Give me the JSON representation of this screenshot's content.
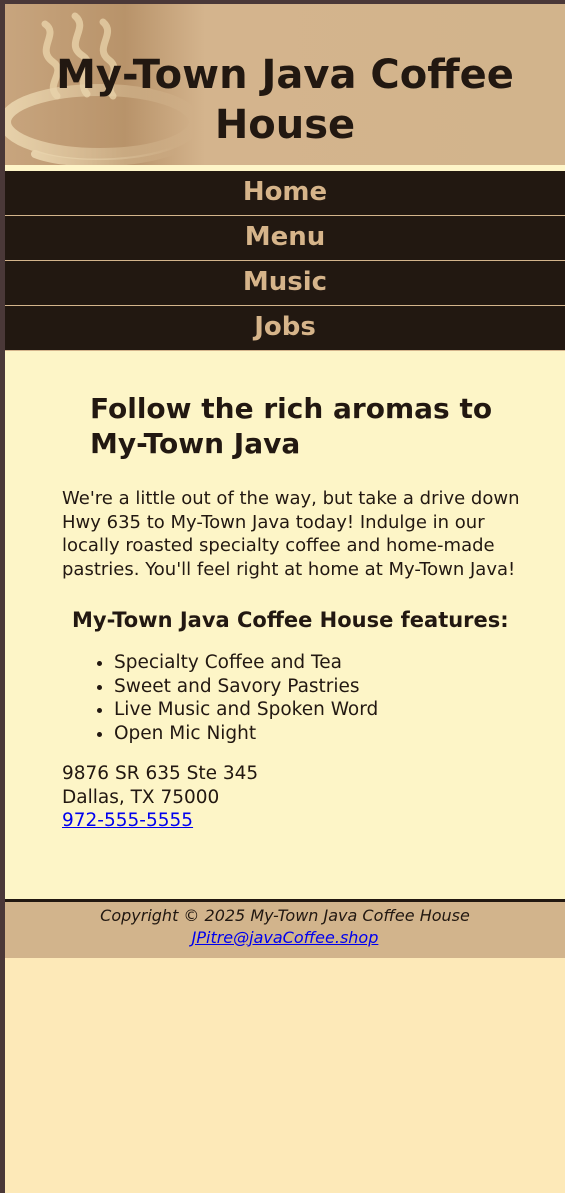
{
  "site": {
    "title": "My-Town Java Coffee House"
  },
  "nav": {
    "items": [
      {
        "label": "Home"
      },
      {
        "label": "Menu"
      },
      {
        "label": "Music"
      },
      {
        "label": "Jobs"
      }
    ]
  },
  "main": {
    "heading": "Follow the rich aromas to My-Town Java",
    "intro": "We're a little out of the way, but take a drive down Hwy 635 to My-Town Java today! Indulge in our locally roasted specialty coffee and home-made pastries. You'll feel right at home at My-Town Java!",
    "features_heading": "My-Town Java Coffee House features:",
    "features": [
      "Specialty Coffee and Tea",
      "Sweet and Savory Pastries",
      "Live Music and Spoken Word",
      "Open Mic Night"
    ],
    "address": {
      "street": "9876 SR 635 Ste 345",
      "city": "Dallas, TX 75000",
      "phone": "972-555-5555"
    }
  },
  "footer": {
    "copyright": "Copyright © 2025 My-Town Java Coffee House",
    "email": "JPitre@javaCoffee.shop"
  },
  "colors": {
    "page_bg": "#4a3838",
    "wrapper_bg": "#fde9b8",
    "header_bg": "#d2b48c",
    "nav_bg": "#221811",
    "nav_text": "#d6b48a",
    "main_bg": "#fdf5c7",
    "text": "#221811",
    "link": "#0000ee"
  },
  "icons": {
    "header_logo": "coffee-cup-steam-icon"
  }
}
